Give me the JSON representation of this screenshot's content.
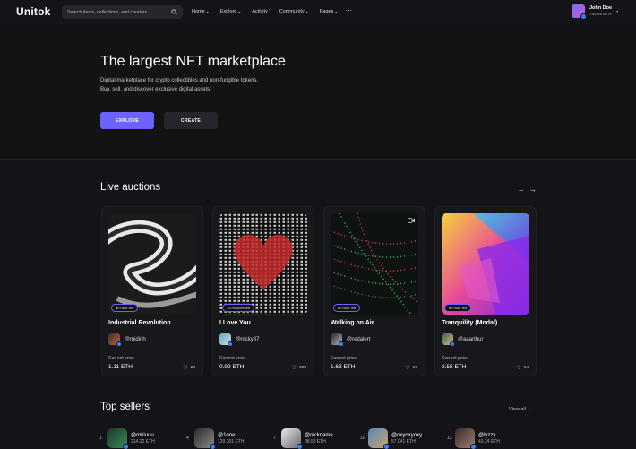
{
  "header": {
    "logo": "Unitok",
    "search_placeholder": "Search items, collections, and creators",
    "nav": [
      {
        "label": "Home",
        "has_dropdown": true
      },
      {
        "label": "Explore",
        "has_dropdown": true
      },
      {
        "label": "Activity",
        "has_dropdown": false
      },
      {
        "label": "Community",
        "has_dropdown": true
      },
      {
        "label": "Pages",
        "has_dropdown": true
      }
    ],
    "more_label": "⋯",
    "user": {
      "name": "John Doe",
      "balance": "784.89 ETH"
    }
  },
  "hero": {
    "title": "The largest NFT marketplace",
    "desc1": "Digital marketplace for crypto collectibles and non-fungible tokens.",
    "desc2": "Buy, sell, and discover exclusive digital assets.",
    "explore_label": "EXPLORE",
    "create_label": "CREATE"
  },
  "auctions": {
    "title": "Live auctions",
    "price_label": "Current price",
    "cards": [
      {
        "title": "Industrial Revolution",
        "time_left": "an hour left",
        "owner": "@midinh",
        "price": "1.11 ETH",
        "likes": "23"
      },
      {
        "title": "I Love You",
        "time_left": "15 minutes left",
        "owner": "@nicky87",
        "price": "0.99 ETH",
        "likes": "358"
      },
      {
        "title": "Walking on Air",
        "time_left": "an hour left",
        "owner": "@redalert",
        "price": "1.63 ETH",
        "likes": "90"
      },
      {
        "title": "Tranquility (Modal)",
        "time_left": "an hour left",
        "owner": "@aaarthur",
        "price": "2.55 ETH",
        "likes": "64"
      }
    ]
  },
  "sellers": {
    "title": "Top sellers",
    "view_all": "View all",
    "items": [
      {
        "rank": "1",
        "name": "@miriuuu",
        "balance": "214.22 ETH"
      },
      {
        "rank": "4",
        "name": "@1one",
        "balance": "129.301 ETH"
      },
      {
        "rank": "7",
        "name": "@nickname",
        "balance": "88.58 ETH"
      },
      {
        "rank": "10",
        "name": "@oxyoxyoxy",
        "balance": "57.041 ETH"
      },
      {
        "rank": "13",
        "name": "@lyzzy",
        "balance": "43.24 ETH"
      }
    ]
  },
  "colors": {
    "accent": "#6c63ff",
    "background": "#141418",
    "card": "#17171c",
    "verified": "#3b82f6"
  }
}
